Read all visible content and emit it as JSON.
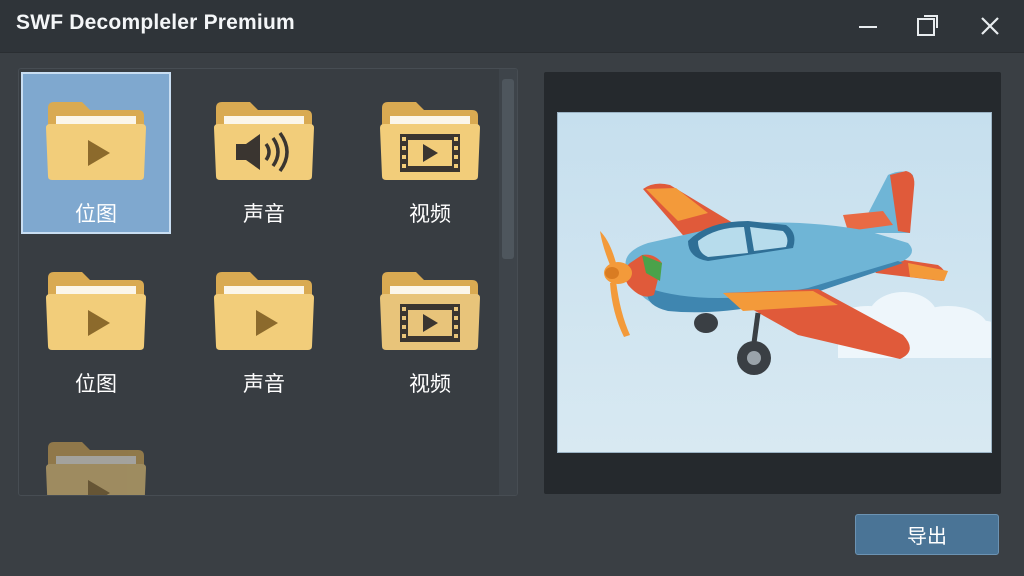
{
  "window": {
    "title": "SWF Decompleler Premium"
  },
  "controls": {
    "minimize": "minimize-icon",
    "maximize": "maximize-icon",
    "close": "close-icon"
  },
  "tiles": [
    {
      "label": "位图",
      "icon": "play-icon",
      "selected": true
    },
    {
      "label": "声音",
      "icon": "speaker-icon",
      "selected": false
    },
    {
      "label": "视频",
      "icon": "film-icon",
      "selected": false
    },
    {
      "label": "位图",
      "icon": "play-icon",
      "selected": false
    },
    {
      "label": "声音",
      "icon": "play-icon",
      "selected": false
    },
    {
      "label": "视频",
      "icon": "film-icon",
      "selected": false
    }
  ],
  "preview": {
    "subject": "airplane-illustration"
  },
  "actions": {
    "export_label": "导出"
  },
  "colors": {
    "window_bg": "#3a3f44",
    "titlebar_bg": "#2f3439",
    "selection": "#7fa8cf",
    "folder": "#f2cd7a",
    "accent_button": "#4a7496"
  }
}
